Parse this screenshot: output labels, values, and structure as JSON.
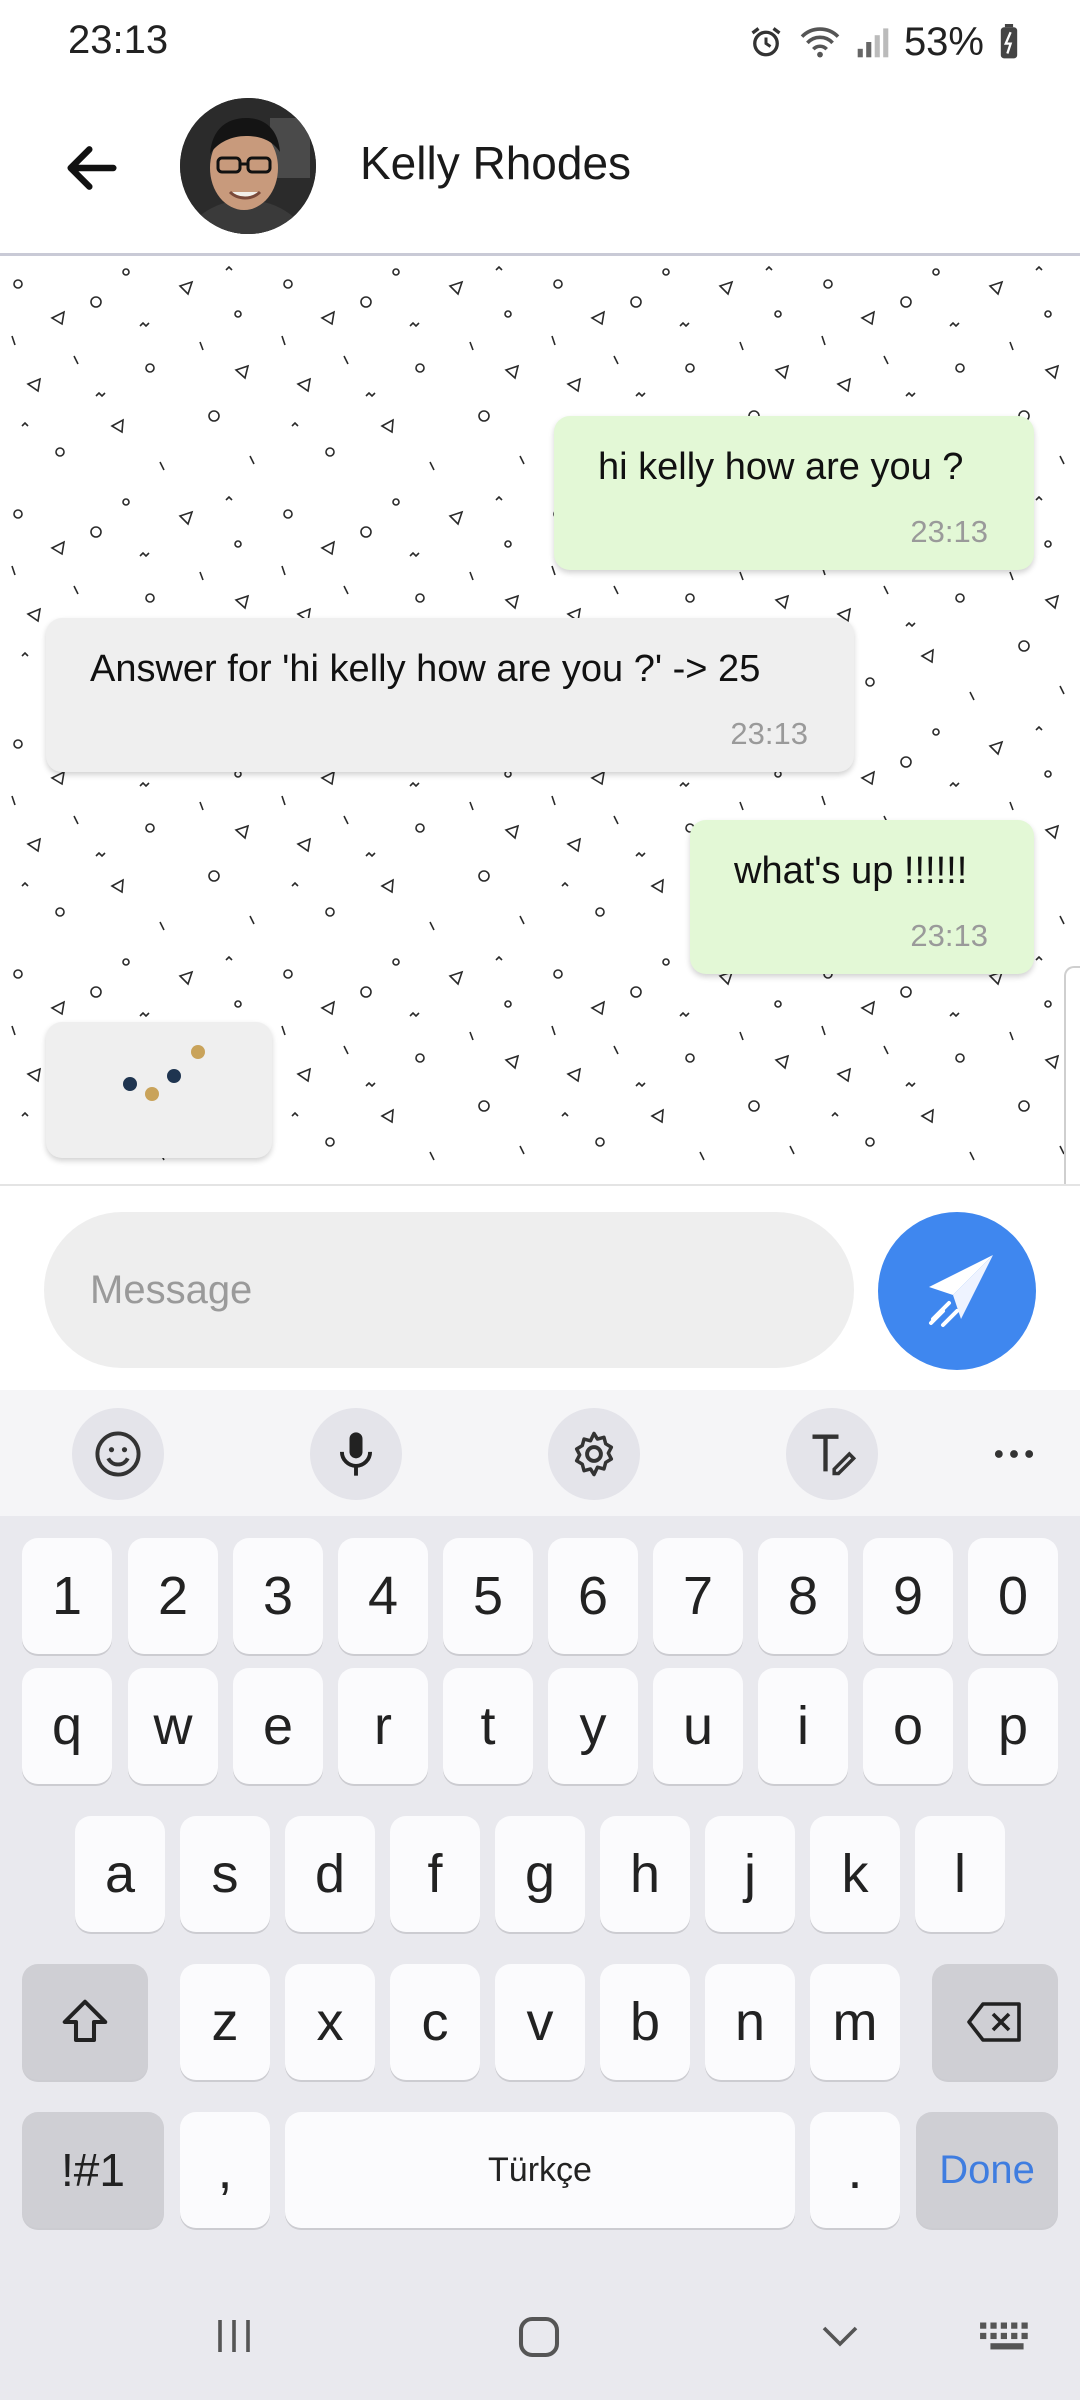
{
  "status_bar": {
    "time": "23:13",
    "battery": "53%"
  },
  "header": {
    "contact_name": "Kelly Rhodes"
  },
  "messages": [
    {
      "direction": "outgoing",
      "text": "hi kelly how are you ?",
      "time": "23:13"
    },
    {
      "direction": "incoming",
      "text": "Answer for 'hi kelly how are you ?' -> 25",
      "time": "23:13"
    },
    {
      "direction": "outgoing",
      "text": "what's up !!!!!!",
      "time": "23:13"
    }
  ],
  "typing_indicator": {
    "dot_colors": [
      "#1f3550",
      "#c9a35a",
      "#1f3550",
      "#c9a35a"
    ]
  },
  "composer": {
    "placeholder": "Message",
    "send_icon": "paper-plane-icon"
  },
  "keyboard": {
    "toolbar": [
      "emoji-icon",
      "microphone-icon",
      "settings-icon",
      "handwriting-icon",
      "more-icon"
    ],
    "rows": [
      [
        "1",
        "2",
        "3",
        "4",
        "5",
        "6",
        "7",
        "8",
        "9",
        "0"
      ],
      [
        "q",
        "w",
        "e",
        "r",
        "t",
        "y",
        "u",
        "i",
        "o",
        "p"
      ],
      [
        "a",
        "s",
        "d",
        "f",
        "g",
        "h",
        "j",
        "k",
        "l"
      ],
      [
        "z",
        "x",
        "c",
        "v",
        "b",
        "n",
        "m"
      ]
    ],
    "symbols_label": "!#1",
    "comma": ",",
    "space_label": "Türkçe",
    "period": ".",
    "done_label": "Done"
  },
  "colors": {
    "accent": "#3f87ef",
    "outgoing_bubble": "#e3f8d6",
    "incoming_bubble": "#efefef"
  }
}
